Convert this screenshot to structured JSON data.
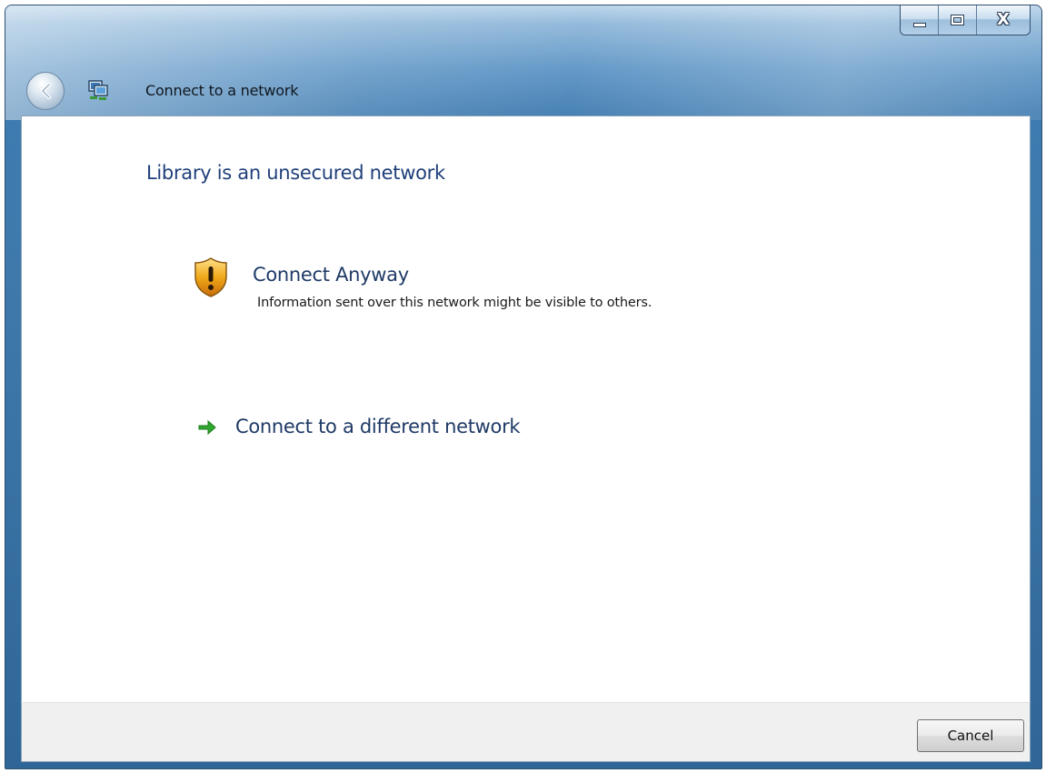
{
  "window": {
    "title": "Connect to a network",
    "caption_buttons": [
      "minimize",
      "maximize",
      "close"
    ]
  },
  "content": {
    "heading": "Library is an unsecured network",
    "connect_anyway": {
      "title": "Connect Anyway",
      "description": "Information sent over this network might be visible to others.",
      "icon": "warning-shield-icon"
    },
    "connect_different": {
      "title": "Connect to a different network",
      "icon": "green-arrow-icon"
    }
  },
  "footer": {
    "cancel_label": "Cancel"
  },
  "colors": {
    "heading": "#1f3f7a",
    "link": "#1f3a66",
    "shield": "#e8a317",
    "arrow": "#2ea82e"
  }
}
